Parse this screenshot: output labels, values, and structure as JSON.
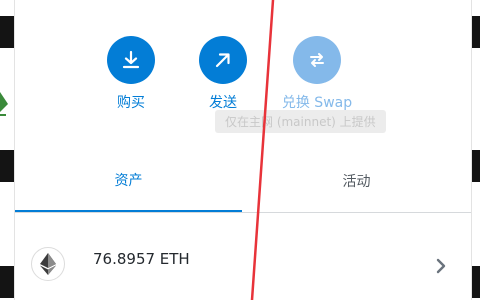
{
  "actions": {
    "buy": {
      "label": "购买",
      "icon": "download-icon"
    },
    "send": {
      "label": "发送",
      "icon": "arrow-up-right-icon"
    },
    "swap": {
      "label": "兑换 Swap",
      "icon": "swap-arrows-icon",
      "disabled": true
    }
  },
  "tooltip": {
    "text": "仅在主网 (mainnet) 上提供"
  },
  "tabs": [
    {
      "label": "资产",
      "active": true
    },
    {
      "label": "活动",
      "active": false
    }
  ],
  "assets": [
    {
      "amount": "76.8957 ETH",
      "icon": "ethereum-icon"
    }
  ],
  "colors": {
    "accent": "#037dd6",
    "disabled_accent": "#84b9ea",
    "annotation": "#e8333a"
  }
}
